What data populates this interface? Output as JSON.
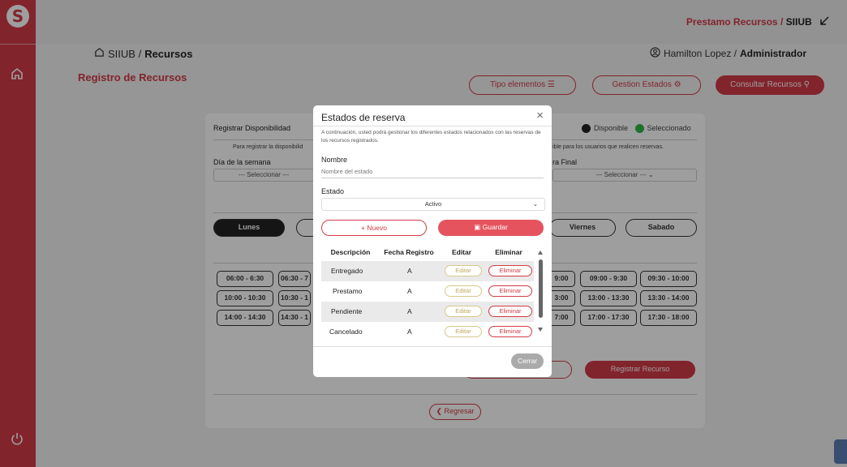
{
  "sidebar": {
    "logo": "S",
    "icons": [
      "home-icon",
      "power-icon"
    ]
  },
  "topbar": {
    "app_link": "Prestamo Recursos",
    "separator": "/",
    "app_name": "SIIUB"
  },
  "breadcrumb": {
    "root": "SIIUB /",
    "current": "Recursos"
  },
  "user": {
    "name": "Hamilton Lopez /",
    "role": "Administrador"
  },
  "page": {
    "title": "Registro de Recursos",
    "btn_tipo": "Tipo elementos",
    "btn_gestion": "Gestion Estados",
    "btn_consultar": "Consultar Recursos"
  },
  "card": {
    "title": "Registrar Disponibilidad",
    "legend_available": "Disponible",
    "legend_selected": "Seleccionado",
    "hint_left": "Para registrar la disponibilid",
    "hint_right": "ible para los usuarios que realicen reservas.",
    "dia_label": "Día de la semana",
    "dia_select": "--- Seleccionar ---",
    "hora_final_label": "ra Final",
    "hora_final_select": "--- Seleccionar ---",
    "days": [
      "Lunes",
      "",
      "Viernes",
      "Sabado"
    ],
    "slots_left": [
      [
        "06:00 - 6:30",
        "06:30 - 7"
      ],
      [
        "10:00 - 10:30",
        "10:30 - 1"
      ],
      [
        "14:00 - 14:30",
        "14:30 - 1"
      ]
    ],
    "slots_right": [
      [
        "9:00",
        "09:00 - 9:30",
        "09:30 - 10:00"
      ],
      [
        "3:00",
        "13:00 - 13:30",
        "13:30 - 14:00"
      ],
      [
        "7:00",
        "17:00 - 17:30",
        "17:30 - 18:00"
      ]
    ],
    "btn_registrar": "Registrar Recurso",
    "btn_regresar": "Regresar"
  },
  "modal": {
    "title": "Estados de reserva",
    "close": "×",
    "description": "A continuación, usted podrá gestionar los diferentes estados relacionados con las reservas de los recursos registrados.",
    "nombre_label": "Nombre",
    "nombre_placeholder": "Nombre del estado",
    "estado_label": "Estado",
    "estado_value": "Activo",
    "btn_nuevo": "+ Nuevo",
    "btn_guardar": "Guardar",
    "columns": [
      "Descripción",
      "Fecha Registro",
      "Editar",
      "Eliminar"
    ],
    "rows": [
      {
        "descripcion": "Entregado",
        "fecha": "A",
        "editar": "Editar",
        "eliminar": "Eliminar"
      },
      {
        "descripcion": "Prestamo",
        "fecha": "A",
        "editar": "Editar",
        "eliminar": "Eliminar"
      },
      {
        "descripcion": "Pendiente",
        "fecha": "A",
        "editar": "Editar",
        "eliminar": "Eliminar"
      },
      {
        "descripcion": "Cancelado",
        "fecha": "A",
        "editar": "Editar",
        "eliminar": "Eliminar"
      }
    ],
    "btn_cerrar": "Cerrar"
  },
  "colors": {
    "accent": "#d23b47",
    "legend_available": "#222222",
    "legend_selected": "#2db84a"
  }
}
